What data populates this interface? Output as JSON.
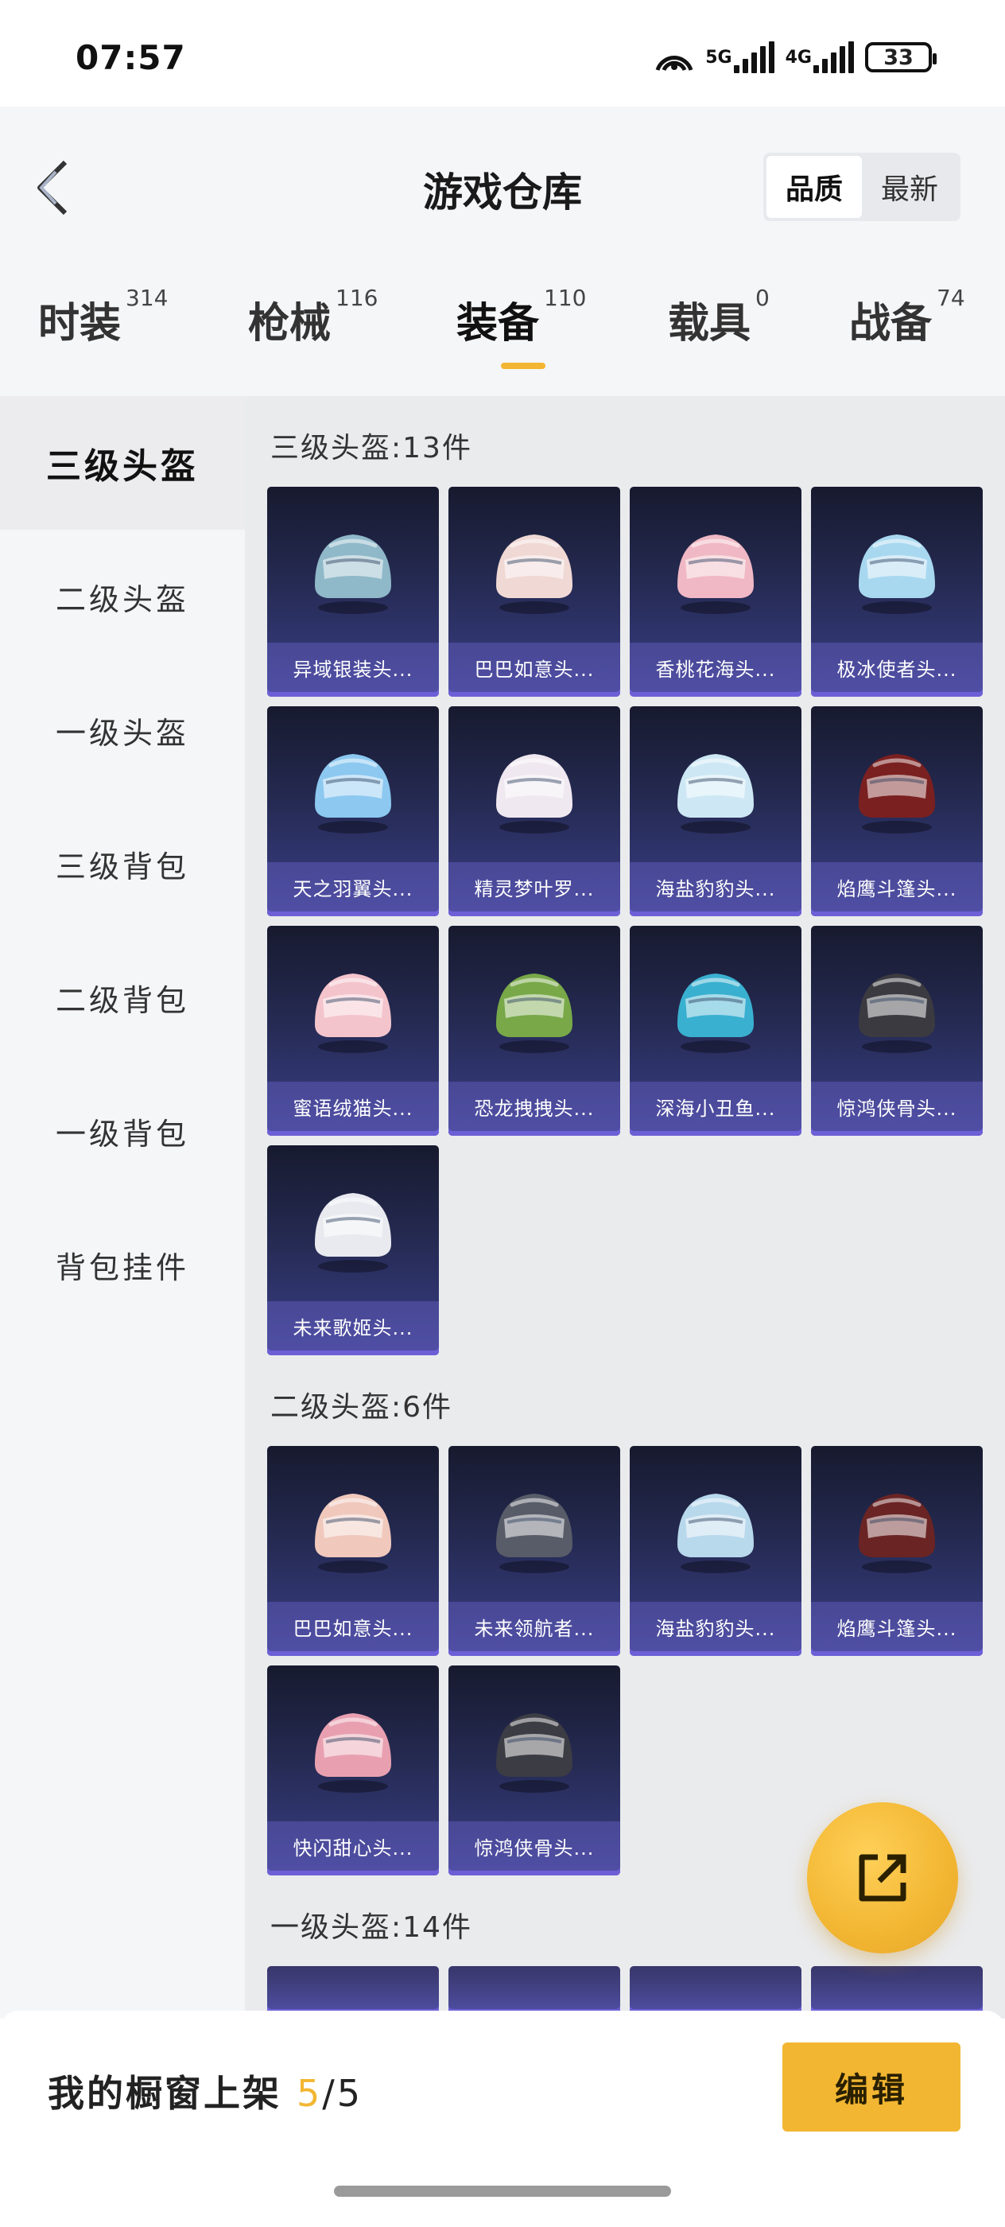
{
  "status_bar": {
    "time": "07:57",
    "net1": "5G",
    "net2": "4G",
    "battery": "33"
  },
  "header": {
    "title": "游戏仓库",
    "sort_options": [
      "品质",
      "最新"
    ],
    "active_sort": "品质"
  },
  "tabs": [
    {
      "label": "时装",
      "count": "314"
    },
    {
      "label": "枪械",
      "count": "116"
    },
    {
      "label": "装备",
      "count": "110"
    },
    {
      "label": "载具",
      "count": "0"
    },
    {
      "label": "战备",
      "count": "74"
    }
  ],
  "sidebar": {
    "items": [
      {
        "label": "三级头盔"
      },
      {
        "label": "二级头盔"
      },
      {
        "label": "一级头盔"
      },
      {
        "label": "三级背包"
      },
      {
        "label": "二级背包"
      },
      {
        "label": "一级背包"
      },
      {
        "label": "背包挂件"
      }
    ]
  },
  "sections": [
    {
      "title": "三级头盔:13件",
      "items": [
        {
          "name": "异域银装头...",
          "color": "#8fb8c8"
        },
        {
          "name": "巴巴如意头...",
          "color": "#f0d8d4"
        },
        {
          "name": "香桃花海头...",
          "color": "#f0b8c4"
        },
        {
          "name": "极冰使者头...",
          "color": "#a8d8f0"
        },
        {
          "name": "天之羽翼头...",
          "color": "#8cc8f0"
        },
        {
          "name": "精灵梦叶罗...",
          "color": "#f0e8f0"
        },
        {
          "name": "海盐豹豹头...",
          "color": "#cde8f4"
        },
        {
          "name": "焰鹰斗篷头...",
          "color": "#7a2020"
        },
        {
          "name": "蜜语绒猫头...",
          "color": "#f4c4cc"
        },
        {
          "name": "恐龙拽拽头...",
          "color": "#78a848"
        },
        {
          "name": "深海小丑鱼...",
          "color": "#3ab0d0"
        },
        {
          "name": "惊鸿侠骨头...",
          "color": "#3a3a40"
        },
        {
          "name": "未来歌姬头...",
          "color": "#e8eaf0"
        }
      ]
    },
    {
      "title": "二级头盔:6件",
      "items": [
        {
          "name": "巴巴如意头...",
          "color": "#f0c8bc"
        },
        {
          "name": "未来领航者...",
          "color": "#585c68"
        },
        {
          "name": "海盐豹豹头...",
          "color": "#b8d8ec"
        },
        {
          "name": "焰鹰斗篷头...",
          "color": "#6a2424"
        },
        {
          "name": "快闪甜心头...",
          "color": "#e8a0b0"
        },
        {
          "name": "惊鸿侠骨头...",
          "color": "#3c3c44"
        }
      ]
    },
    {
      "title": "一级头盔:14件",
      "items": [
        {
          "name": "",
          "color": "#dcdcdc"
        },
        {
          "name": "",
          "color": "#4a4a4a"
        },
        {
          "name": "",
          "color": "#b0b8c0"
        },
        {
          "name": "",
          "color": "#e8e8e8"
        }
      ]
    }
  ],
  "bottom": {
    "showcase_label": "我的橱窗上架",
    "showcase_used": "5",
    "showcase_total": "/5",
    "edit_label": "编辑"
  },
  "colors": {
    "accent": "#f2b632",
    "card_top": "#171a2e",
    "card_bottom": "#3a3f89"
  }
}
